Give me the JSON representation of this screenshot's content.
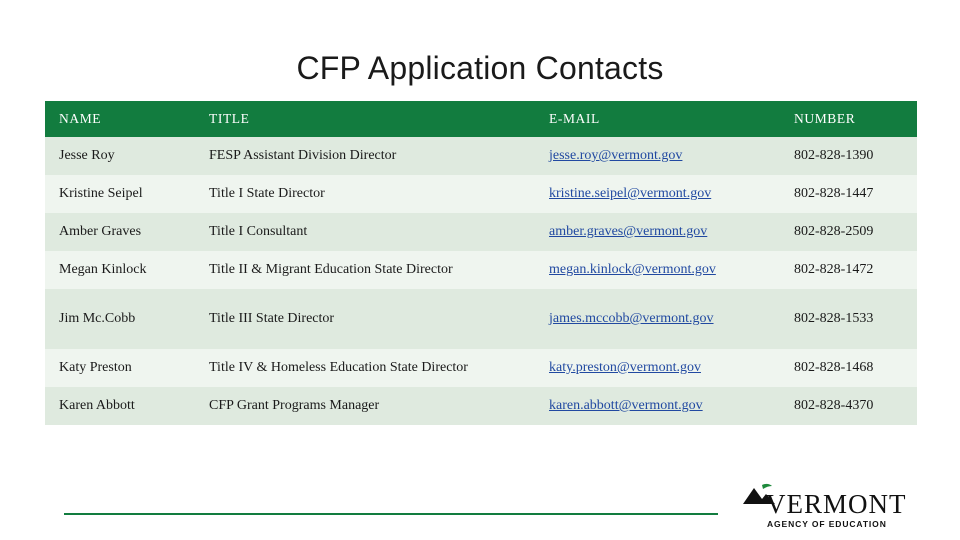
{
  "slide": {
    "title": "CFP Application Contacts"
  },
  "table": {
    "headers": [
      "NAME",
      "TITLE",
      "E-MAIL",
      "NUMBER"
    ],
    "rows": [
      {
        "name": "Jesse Roy",
        "title": "FESP Assistant Division Director",
        "email": "jesse.roy@vermont.gov",
        "number": "802-828-1390"
      },
      {
        "name": "Kristine Seipel",
        "title": "Title I State Director",
        "email": "kristine.seipel@vermont.gov",
        "number": "802-828-1447"
      },
      {
        "name": "Amber Graves",
        "title": "Title I Consultant",
        "email": "amber.graves@vermont.gov",
        "number": "802-828-2509"
      },
      {
        "name": "Megan Kinlock",
        "title": "Title II & Migrant Education State Director",
        "email": "megan.kinlock@vermont.gov",
        "number": "802-828-1472"
      },
      {
        "name": "Jim Mc.Cobb",
        "title": "Title III State Director",
        "email": "james.mccobb@vermont.gov",
        "number": "802-828-1533"
      },
      {
        "name": "Katy Preston",
        "title": "Title IV & Homeless Education State Director",
        "email": "katy.preston@vermont.gov",
        "number": "802-828-1468"
      },
      {
        "name": "Karen Abbott",
        "title": "CFP Grant Programs Manager",
        "email": "karen.abbott@vermont.gov",
        "number": "802-828-4370"
      }
    ]
  },
  "logo": {
    "word": "VERMONT",
    "subtitle": "AGENCY OF EDUCATION"
  },
  "colors": {
    "header_green": "#127c3f",
    "band_a": "#dfeadf",
    "band_b": "#eff5ef",
    "link_blue": "#2149a1"
  }
}
